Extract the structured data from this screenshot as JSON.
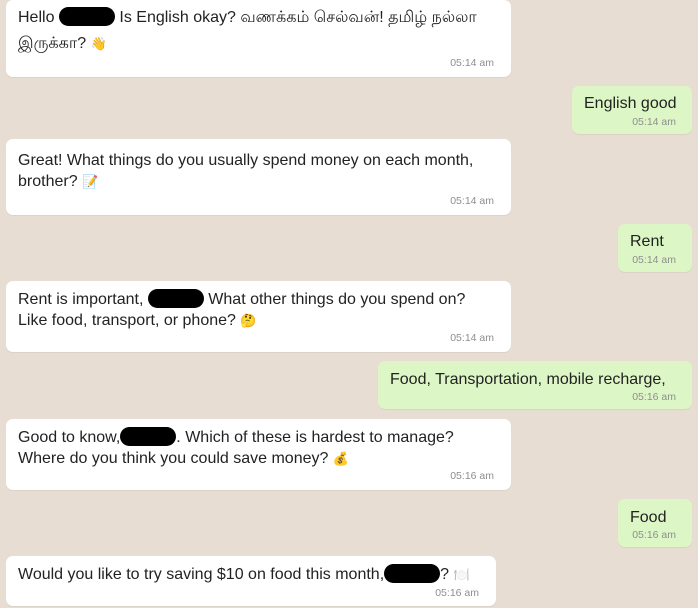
{
  "messages": [
    {
      "side": "in",
      "lines": [
        "Hello ▮ Is English okay? வணக்கம் செல்வன்! தமிழ் நல்லா",
        "இருக்கா? 👋"
      ],
      "time": "05:14 am"
    },
    {
      "side": "out",
      "lines": [
        "English good"
      ],
      "time": "05:14 am"
    },
    {
      "side": "in",
      "lines": [
        "Great! What things do you usually spend money on each month,",
        "brother? 📝"
      ],
      "time": "05:14 am"
    },
    {
      "side": "out",
      "lines": [
        "Rent"
      ],
      "time": "05:14 am"
    },
    {
      "side": "in",
      "lines": [
        "Rent is important, ▮ What other things do you spend on?",
        "Like food, transport, or phone? 🤔"
      ],
      "time": "05:14 am"
    },
    {
      "side": "out",
      "lines": [
        "Food, Transportation, mobile recharge,"
      ],
      "time": "05:16 am"
    },
    {
      "side": "in",
      "lines": [
        "Good to know, ▮. Which of these is hardest to manage?",
        "Where do you think you could save money? 💰"
      ],
      "time": "05:16 am"
    },
    {
      "side": "out",
      "lines": [
        "Food"
      ],
      "time": "05:16 am"
    },
    {
      "side": "in",
      "lines": [
        "Would you like to try saving $10 on food this month, ▮? 🍽️"
      ],
      "time": "05:16 am"
    }
  ],
  "m1": {
    "a": "Hello",
    "b": "Is English okay? வணக்கம் செல்வன்! தமிழ் நல்லா",
    "c": "இருக்கா?",
    "e": "👋",
    "time": "05:14 am"
  },
  "m2": {
    "text": "English good",
    "time": "05:14 am"
  },
  "m3": {
    "a": "Great! What things do you usually spend money on each month,",
    "b": "brother?",
    "e": "📝",
    "time": "05:14 am"
  },
  "m4": {
    "text": "Rent",
    "time": "05:14 am"
  },
  "m5": {
    "a": "Rent is important,",
    "b": "What other things do you spend on?",
    "c": "Like food, transport, or phone?",
    "e": "🤔",
    "time": "05:14 am"
  },
  "m6": {
    "text": "Food, Transportation, mobile recharge,",
    "time": "05:16 am"
  },
  "m7": {
    "a": "Good to know,",
    "b": ". Which of these is hardest to manage?",
    "c": "Where do you think you could save money?",
    "e": "💰",
    "time": "05:16 am"
  },
  "m8": {
    "text": "Food",
    "time": "05:16 am"
  },
  "m9": {
    "a": "Would you like to try saving $10 on food this month,",
    "b": "?",
    "e": "🍽️",
    "time": "05:16 am"
  },
  "colors": {
    "background": "#e8ddd3",
    "incoming": "#ffffff",
    "outgoing": "#dcf7c5",
    "time": "#8e8e8e"
  }
}
